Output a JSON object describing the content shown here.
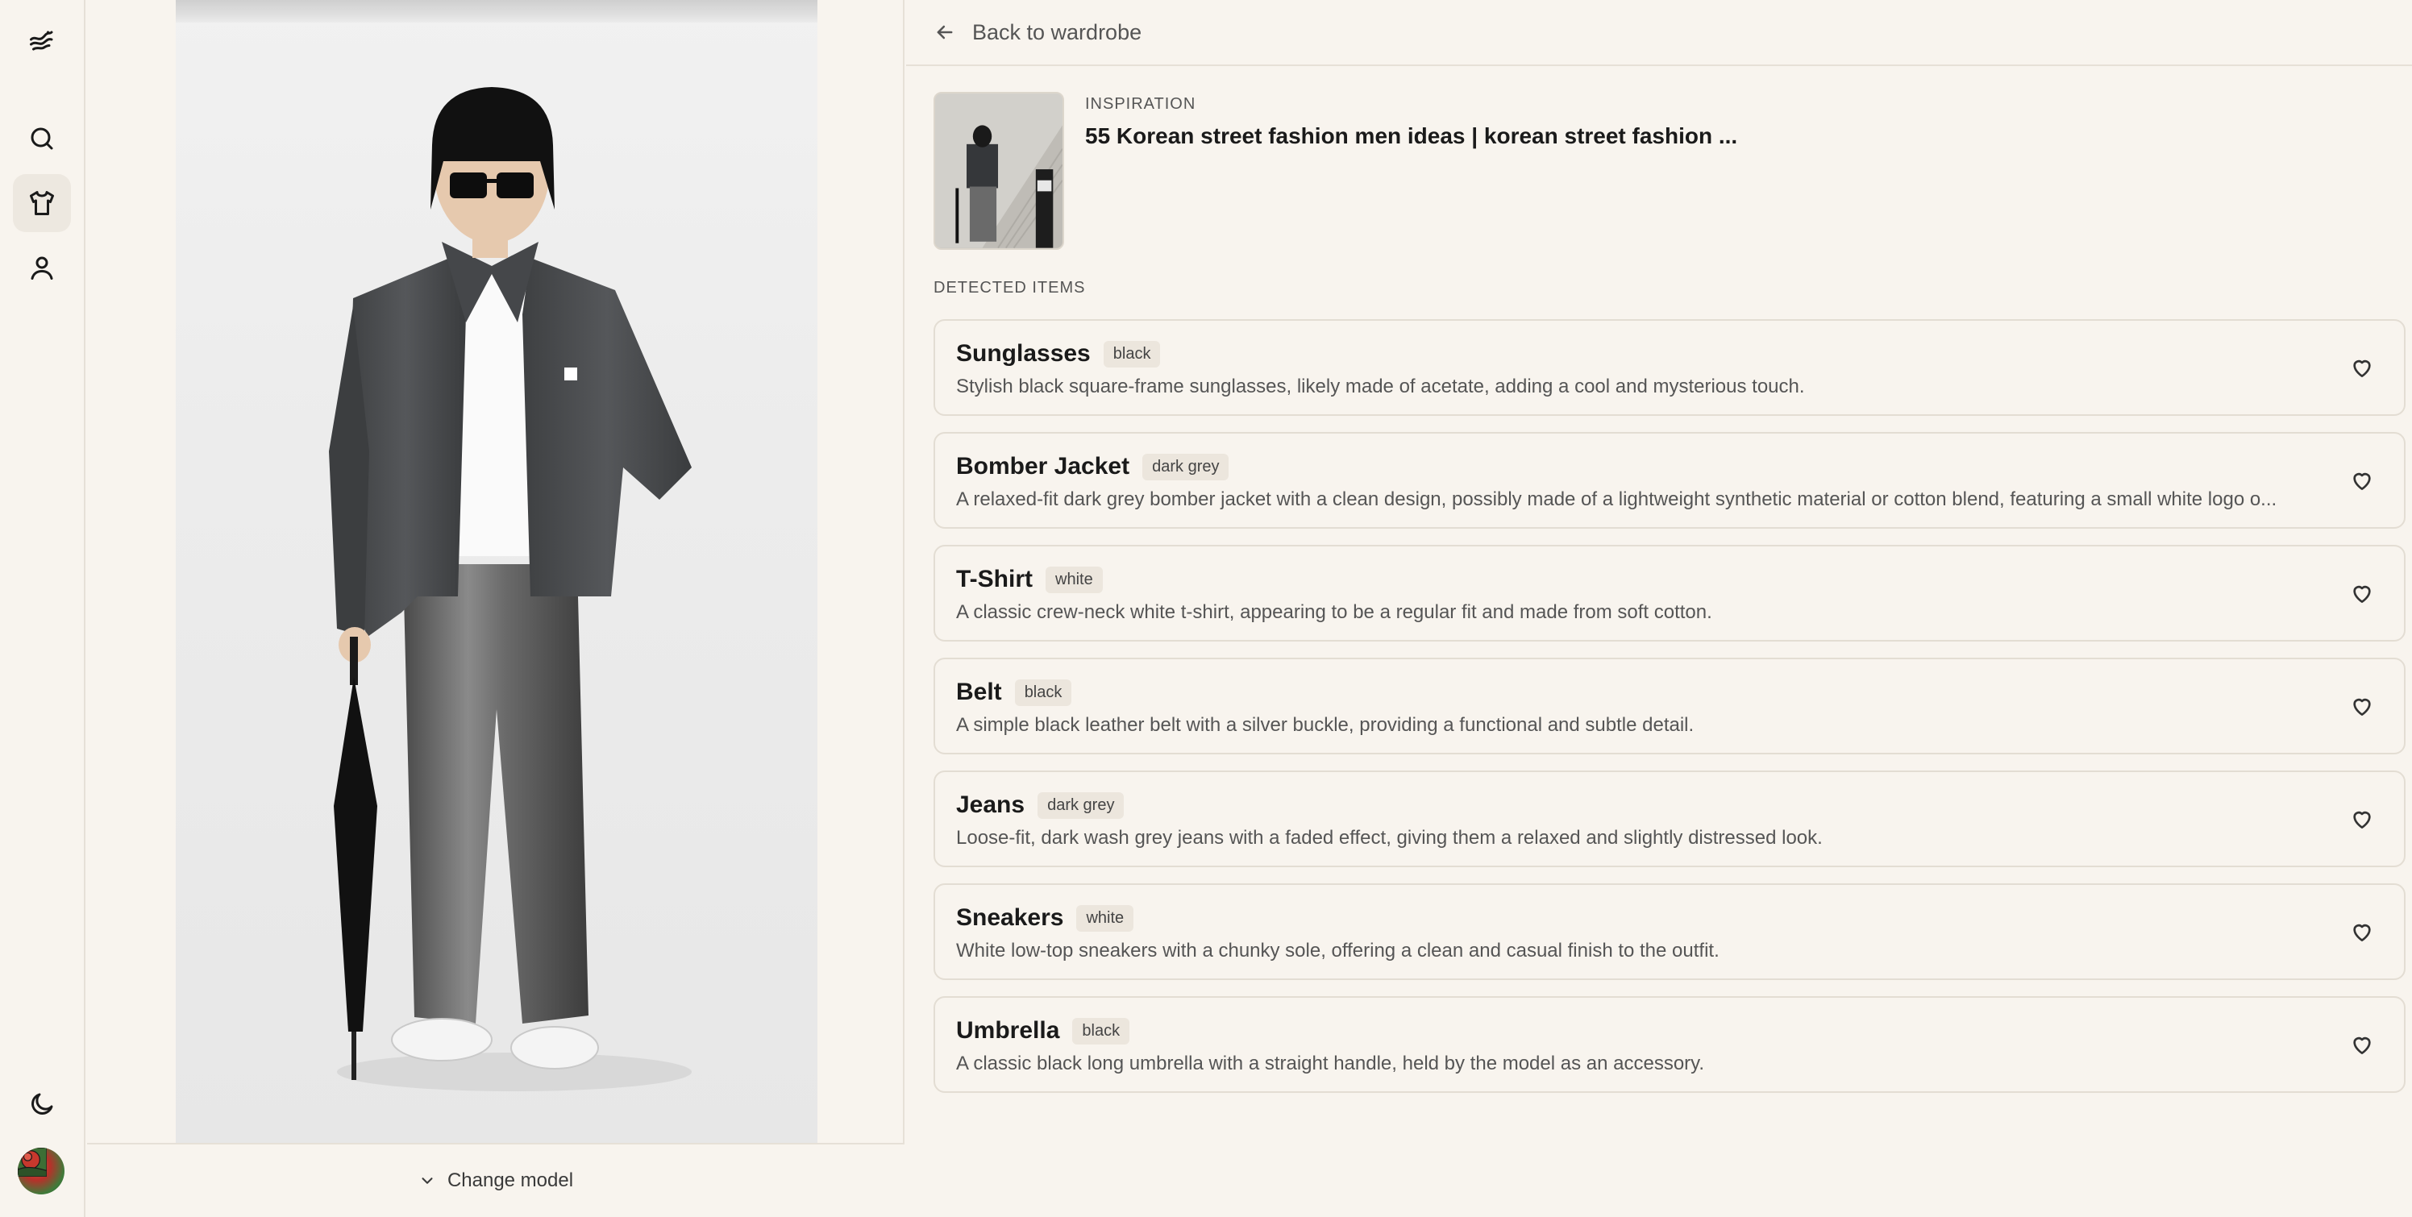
{
  "nav": {
    "items": [
      {
        "icon": "logo-wind-icon"
      },
      {
        "icon": "search-icon"
      },
      {
        "icon": "shirt-icon",
        "active": true
      },
      {
        "icon": "user-icon"
      }
    ],
    "bottom": [
      {
        "icon": "moon-icon"
      },
      {
        "icon": "avatar"
      }
    ]
  },
  "photo": {
    "change_model_label": "Change model",
    "change_model_icon": "chevron-down-icon"
  },
  "header": {
    "back_label": "Back to wardrobe",
    "back_icon": "arrow-left-icon"
  },
  "inspiration": {
    "eyebrow": "INSPIRATION",
    "title": "55 Korean street fashion men ideas | korean street fashion ..."
  },
  "detected": {
    "label": "DETECTED ITEMS",
    "items": [
      {
        "name": "Sunglasses",
        "color": "black",
        "description": "Stylish black square-frame sunglasses, likely made of acetate, adding a cool and mysterious touch."
      },
      {
        "name": "Bomber Jacket",
        "color": "dark grey",
        "description": "A relaxed-fit dark grey bomber jacket with a clean design, possibly made of a lightweight synthetic material or cotton blend, featuring a small white logo o..."
      },
      {
        "name": "T-Shirt",
        "color": "white",
        "description": "A classic crew-neck white t-shirt, appearing to be a regular fit and made from soft cotton."
      },
      {
        "name": "Belt",
        "color": "black",
        "description": "A simple black leather belt with a silver buckle, providing a functional and subtle detail."
      },
      {
        "name": "Jeans",
        "color": "dark grey",
        "description": "Loose-fit, dark wash grey jeans with a faded effect, giving them a relaxed and slightly distressed look."
      },
      {
        "name": "Sneakers",
        "color": "white",
        "description": "White low-top sneakers with a chunky sole, offering a clean and casual finish to the outfit."
      },
      {
        "name": "Umbrella",
        "color": "black",
        "description": "A classic black long umbrella with a straight handle, held by the model as an accessory."
      }
    ]
  },
  "colors": {
    "background": "#f8f4ee",
    "border": "#e3ddd3",
    "tag_bg": "#ece6dd",
    "text": "#1a1a1a",
    "muted": "#555555"
  }
}
